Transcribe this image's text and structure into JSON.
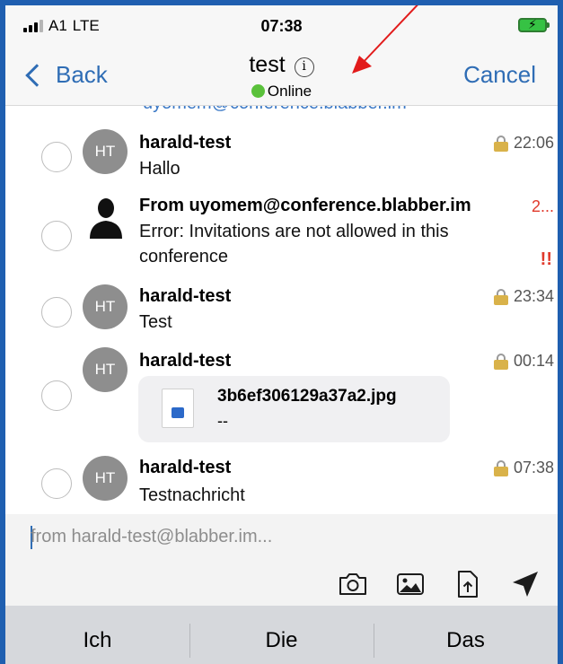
{
  "status_bar": {
    "carrier": "A1",
    "network": "LTE",
    "time": "07:38",
    "battery_state": "charging",
    "battery_color": "#36c244"
  },
  "nav": {
    "back_label": "Back",
    "title": "test",
    "info_icon": "info-icon",
    "presence": "Online",
    "presence_color": "#5ac13b",
    "cancel_label": "Cancel",
    "accent_color": "#2f6db5"
  },
  "list": {
    "cut_text": "uyomem@conference.blabber.im",
    "messages": [
      {
        "avatar": "HT",
        "sender": "harald-test",
        "body": "Hallo",
        "time": "22:06",
        "encrypted": true
      },
      {
        "avatar": "person-icon",
        "sender": "From uyomem@conference.blabber.im",
        "body_line1": "Error: Invitations are not allowed in this",
        "body_line2": "conference",
        "time": "2...",
        "error_mark": "!!"
      },
      {
        "avatar": "HT",
        "sender": "harald-test",
        "body": "Test",
        "time": "23:34",
        "encrypted": true
      },
      {
        "avatar": "HT",
        "sender": "harald-test",
        "time": "00:14",
        "encrypted": true,
        "attachment": {
          "file_name": "3b6ef306129a37a2.jpg",
          "file_size": "--"
        }
      },
      {
        "avatar": "HT",
        "sender": "harald-test",
        "body": "Testnachricht",
        "time": "07:38",
        "encrypted": true
      }
    ]
  },
  "composer": {
    "placeholder": "from harald-test@blabber.im...",
    "tools": [
      "camera-icon",
      "image-icon",
      "file-upload-icon",
      "send-icon"
    ]
  },
  "keyboard": {
    "suggestions": [
      "Ich",
      "Die",
      "Das"
    ]
  }
}
